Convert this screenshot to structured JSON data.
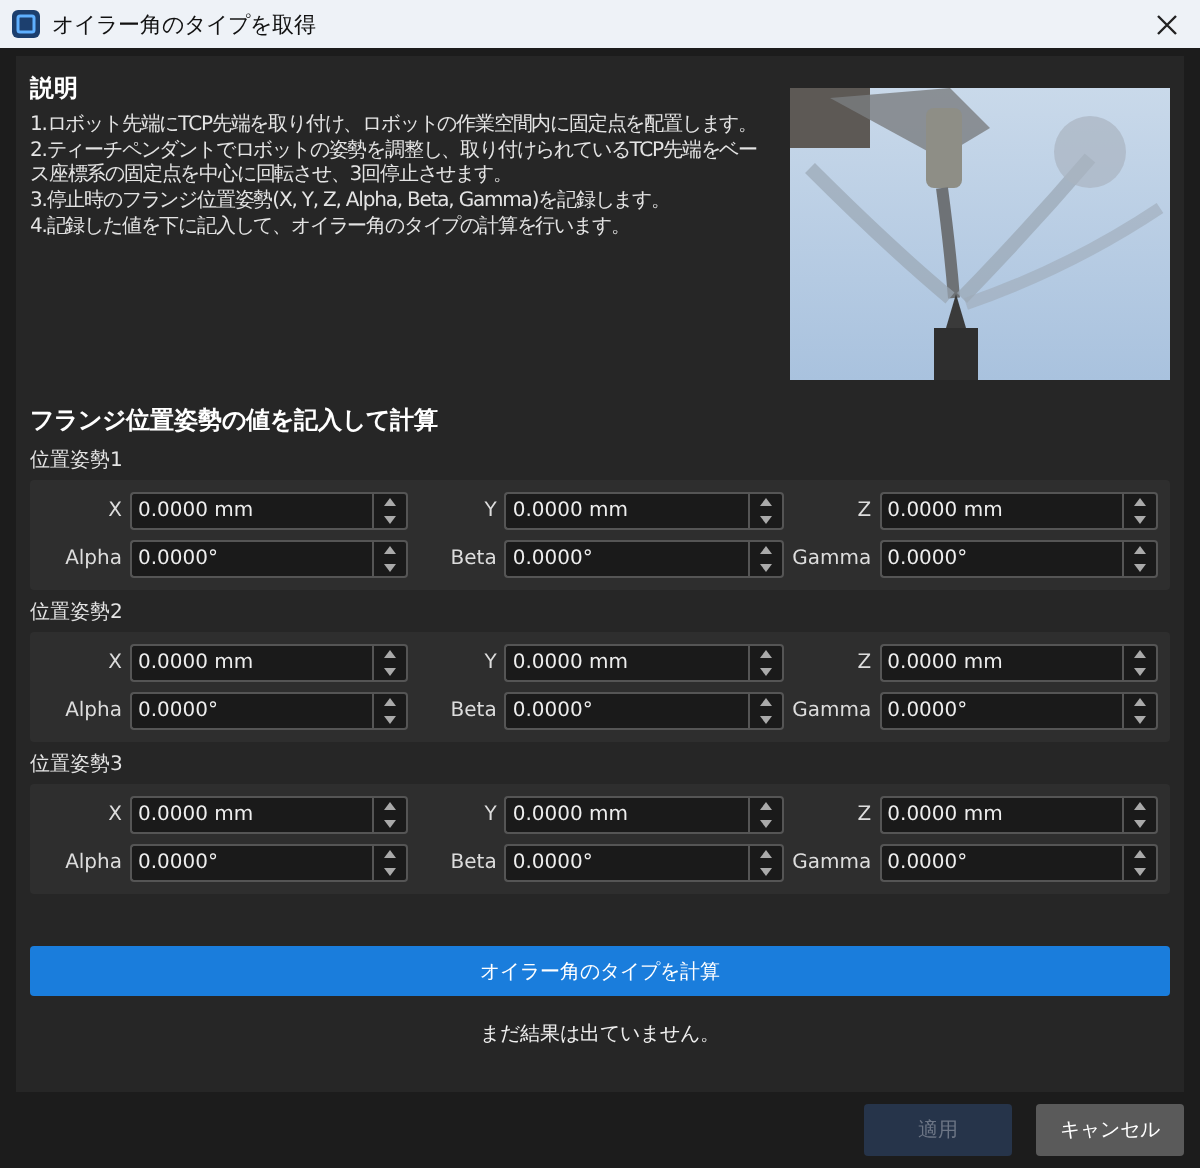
{
  "window": {
    "title": "オイラー角のタイプを取得"
  },
  "description": {
    "heading": "説明",
    "steps": [
      "1.ロボット先端にTCP先端を取り付け、ロボットの作業空間内に固定点を配置します。",
      "2.ティーチペンダントでロボットの姿勢を調整し、取り付けられているTCP先端をベース座標系の固定点を中心に回転させ、3回停止させます。",
      "3.停止時のフランジ位置姿勢(X, Y, Z, Alpha, Beta, Gamma)を記録します。",
      "4.記録した値を下に記入して、オイラー角のタイプの計算を行います。"
    ]
  },
  "section_title": "フランジ位置姿勢の値を記入して計算",
  "poses": [
    {
      "label": "位置姿勢1",
      "fields": [
        {
          "label": "X",
          "value": "0.0000 mm"
        },
        {
          "label": "Y",
          "value": "0.0000 mm"
        },
        {
          "label": "Z",
          "value": "0.0000 mm"
        },
        {
          "label": "Alpha",
          "value": "0.0000°"
        },
        {
          "label": "Beta",
          "value": "0.0000°"
        },
        {
          "label": "Gamma",
          "value": "0.0000°"
        }
      ]
    },
    {
      "label": "位置姿勢2",
      "fields": [
        {
          "label": "X",
          "value": "0.0000 mm"
        },
        {
          "label": "Y",
          "value": "0.0000 mm"
        },
        {
          "label": "Z",
          "value": "0.0000 mm"
        },
        {
          "label": "Alpha",
          "value": "0.0000°"
        },
        {
          "label": "Beta",
          "value": "0.0000°"
        },
        {
          "label": "Gamma",
          "value": "0.0000°"
        }
      ]
    },
    {
      "label": "位置姿勢3",
      "fields": [
        {
          "label": "X",
          "value": "0.0000 mm"
        },
        {
          "label": "Y",
          "value": "0.0000 mm"
        },
        {
          "label": "Z",
          "value": "0.0000 mm"
        },
        {
          "label": "Alpha",
          "value": "0.0000°"
        },
        {
          "label": "Beta",
          "value": "0.0000°"
        },
        {
          "label": "Gamma",
          "value": "0.0000°"
        }
      ]
    }
  ],
  "calculate_button": "オイラー角のタイプを計算",
  "result": "まだ結果は出ていません。",
  "buttons": [
    {
      "label": "適用",
      "disabled": true
    },
    {
      "label": "キャンセル",
      "disabled": false
    }
  ]
}
